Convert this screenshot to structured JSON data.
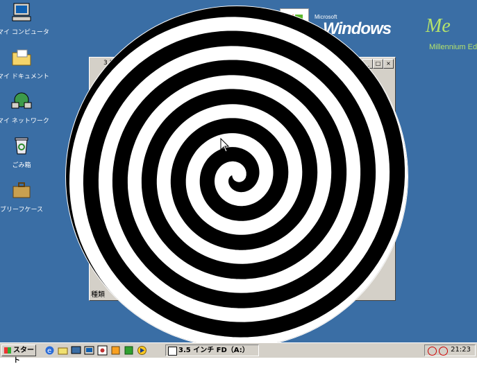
{
  "desktop_icons": [
    {
      "label": "マイ コンピュータ",
      "icon": "my-computer-icon"
    },
    {
      "label": "マイ ドキュメント",
      "icon": "my-documents-icon"
    },
    {
      "label": "マイ ネットワーク",
      "icon": "network-icon"
    },
    {
      "label": "ごみ箱",
      "icon": "recycle-bin-icon"
    },
    {
      "label": "ブリーフケース",
      "icon": "briefcase-icon"
    }
  ],
  "logo": {
    "microsoft": "Microsoft",
    "windows": "Windows",
    "me": "Me",
    "edition": "Millennium Edition"
  },
  "background_window": {
    "title": "3.5",
    "status": "種類"
  },
  "taskbar": {
    "start_label": "スタート",
    "task_button_label": "3.5 インチ FD（A:）",
    "clock": "21:23",
    "quick_launch": [
      "ie-icon",
      "outlook-icon",
      "desktop-icon",
      "channels-icon",
      "media-icon",
      "app-icon",
      "app2-icon",
      "media-player-icon"
    ]
  },
  "colors": {
    "desktop": "#3a6ea5",
    "taskbar": "#d4d0c8",
    "logo_accent": "#b5e36b"
  }
}
